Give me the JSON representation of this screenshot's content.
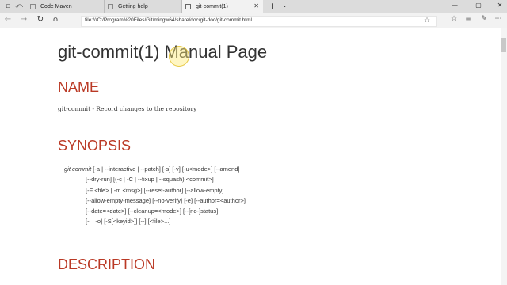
{
  "tabs": [
    {
      "title": "Code Maven",
      "active": false
    },
    {
      "title": "Getting help",
      "active": false
    },
    {
      "title": "git-commit(1)",
      "active": true
    }
  ],
  "address": {
    "url": "file:///C:/Program%20Files/Git/mingw64/share/doc/git-doc/git-commit.html"
  },
  "page": {
    "title": "git-commit(1) Manual Page",
    "name_heading": "NAME",
    "name_text": "git-commit - Record changes to the repository",
    "synopsis_heading": "SYNOPSIS",
    "synopsis_command": "git commit",
    "synopsis_first_args": " [-a | --interactive | --patch] [-s] [-v] [-u<mode>] [--amend]",
    "synopsis_lines": [
      "[--dry-run] [(-c | -C | --fixup | --squash) <commit>]",
      "[-F <file> | -m <msg>] [--reset-author] [--allow-empty]",
      "[--allow-empty-message] [--no-verify] [-e] [--author=<author>]",
      "[--date=<date>] [--cleanup=<mode>] [--[no-]status]",
      "[-i | -o] [-S[<keyid>]] [--] [<file>...]"
    ],
    "description_heading": "DESCRIPTION"
  },
  "colors": {
    "heading": "#ba3925",
    "text": "#333333",
    "tabstrip": "#dcdcdc",
    "active_tab": "#f2f2f2"
  },
  "icons": {
    "tab_controls": [
      "tab-list-icon",
      "tab-back-icon"
    ],
    "tab_favicon": "page-icon",
    "nav": [
      "back-arrow-icon",
      "forward-arrow-icon",
      "refresh-icon",
      "home-icon"
    ],
    "right": [
      "favorite-star-icon",
      "favorites-hub-icon",
      "reading-list-icon",
      "share-icon",
      "more-icon"
    ],
    "window": [
      "minimize-icon",
      "maximize-icon",
      "close-icon"
    ]
  }
}
